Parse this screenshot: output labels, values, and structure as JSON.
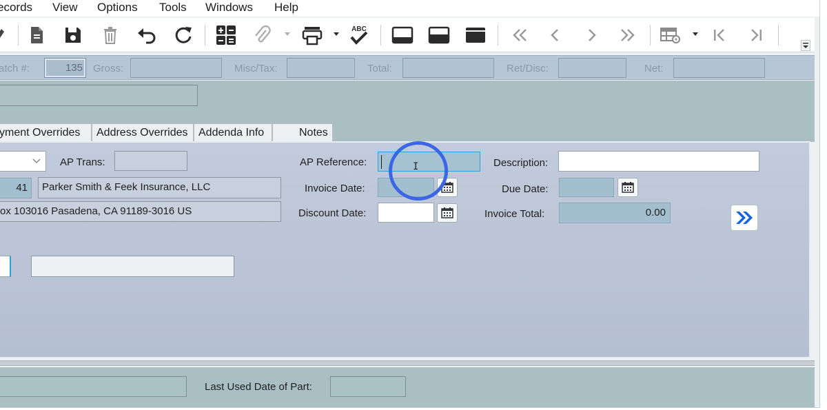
{
  "menu": [
    "ecords",
    "View",
    "Options",
    "Tools",
    "Windows",
    "Help"
  ],
  "toolbar": {
    "buttons": [
      {
        "name": "new-icon"
      },
      {
        "name": "save-icon"
      },
      {
        "name": "delete-icon"
      },
      {
        "name": "undo-icon"
      },
      {
        "name": "refresh-icon"
      },
      {
        "name": "calculator-icon"
      },
      {
        "name": "attach-icon"
      },
      {
        "name": "print-icon"
      },
      {
        "name": "spellcheck-icon"
      },
      {
        "name": "layout-bottom-icon"
      },
      {
        "name": "layout-split-icon"
      },
      {
        "name": "layout-top-icon"
      },
      {
        "name": "first-record-icon"
      },
      {
        "name": "previous-record-icon"
      },
      {
        "name": "next-record-icon"
      },
      {
        "name": "last-record-icon"
      },
      {
        "name": "grid-settings-icon"
      },
      {
        "name": "first-page-icon"
      },
      {
        "name": "last-page-icon"
      }
    ],
    "spellcheck_text": "ABC"
  },
  "batch_bar": {
    "batch_label": "atch #:",
    "batch_value": "135",
    "gross_label": "Gross:",
    "misc_tax_label": "Misc/Tax:",
    "total_label": "Total:",
    "ret_disc_label": "Ret/Disc:",
    "net_label": "Net:"
  },
  "tabs": [
    "yment Overrides",
    "Address Overrides",
    "Addenda Info",
    "Notes"
  ],
  "form": {
    "ap_trans_label": "AP Trans:",
    "ap_reference_label": "AP Reference:",
    "description_label": "Description:",
    "vendor_id": "41",
    "vendor_name": "Parker Smith & Feek Insurance, LLC",
    "vendor_address": "ox 103016  Pasadena, CA  91189-3016  US",
    "invoice_date_label": "Invoice Date:",
    "due_date_label": "Due Date:",
    "discount_date_label": "Discount Date:",
    "invoice_total_label": "Invoice Total:",
    "invoice_total_value": "0.00"
  },
  "bottom": {
    "last_used_label": "Last Used Date of Part:"
  },
  "colors": {
    "accent_ring": "#3c66e6",
    "next_arrow": "#1565d8"
  }
}
